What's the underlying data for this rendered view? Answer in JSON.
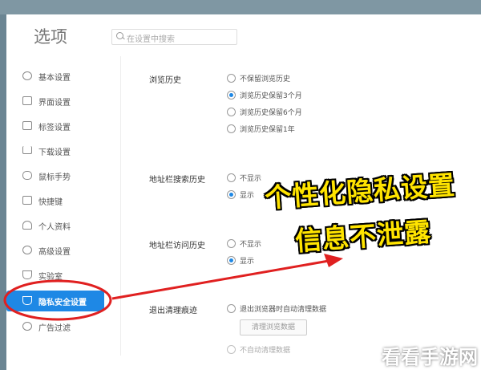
{
  "window": {
    "title": "选项"
  },
  "search": {
    "placeholder": "在设置中搜索"
  },
  "sidebar": {
    "items": [
      {
        "label": "基本设置",
        "icon": "gear-icon"
      },
      {
        "label": "界面设置",
        "icon": "window-icon"
      },
      {
        "label": "标签设置",
        "icon": "tab-icon"
      },
      {
        "label": "下载设置",
        "icon": "download-icon"
      },
      {
        "label": "鼠标手势",
        "icon": "mouse-icon"
      },
      {
        "label": "快捷键",
        "icon": "keyboard-icon"
      },
      {
        "label": "个人资料",
        "icon": "user-icon"
      },
      {
        "label": "高级设置",
        "icon": "advanced-icon"
      },
      {
        "label": "实验室",
        "icon": "flask-icon"
      },
      {
        "label": "隐私安全设置",
        "icon": "shield-icon",
        "active": true
      },
      {
        "label": "广告过滤",
        "icon": "block-icon"
      }
    ]
  },
  "history": {
    "title": "浏览历史",
    "options": [
      "不保留浏览历史",
      "浏览历史保留3个月",
      "浏览历史保留6个月",
      "浏览历史保留1年"
    ],
    "selected": 1
  },
  "address_search": {
    "title": "地址栏搜索历史",
    "options": [
      "不显示",
      "显示"
    ],
    "selected": 1
  },
  "address_visit": {
    "title": "地址栏访问历史",
    "options": [
      "不显示",
      "显示"
    ],
    "selected": 1
  },
  "clear_traces": {
    "title": "退出清理痕迹",
    "option": "退出浏览器时自动清理数据",
    "button": "清理浏览数据",
    "option2": "不自动清理数据"
  },
  "overlay": {
    "line1": "个性化隐私设置",
    "line2": "信息不泄露"
  },
  "watermark": "看看手游网",
  "colors": {
    "accent": "#1e88e5",
    "annotation": "#e02020",
    "overlay_text": "#ffe400"
  }
}
